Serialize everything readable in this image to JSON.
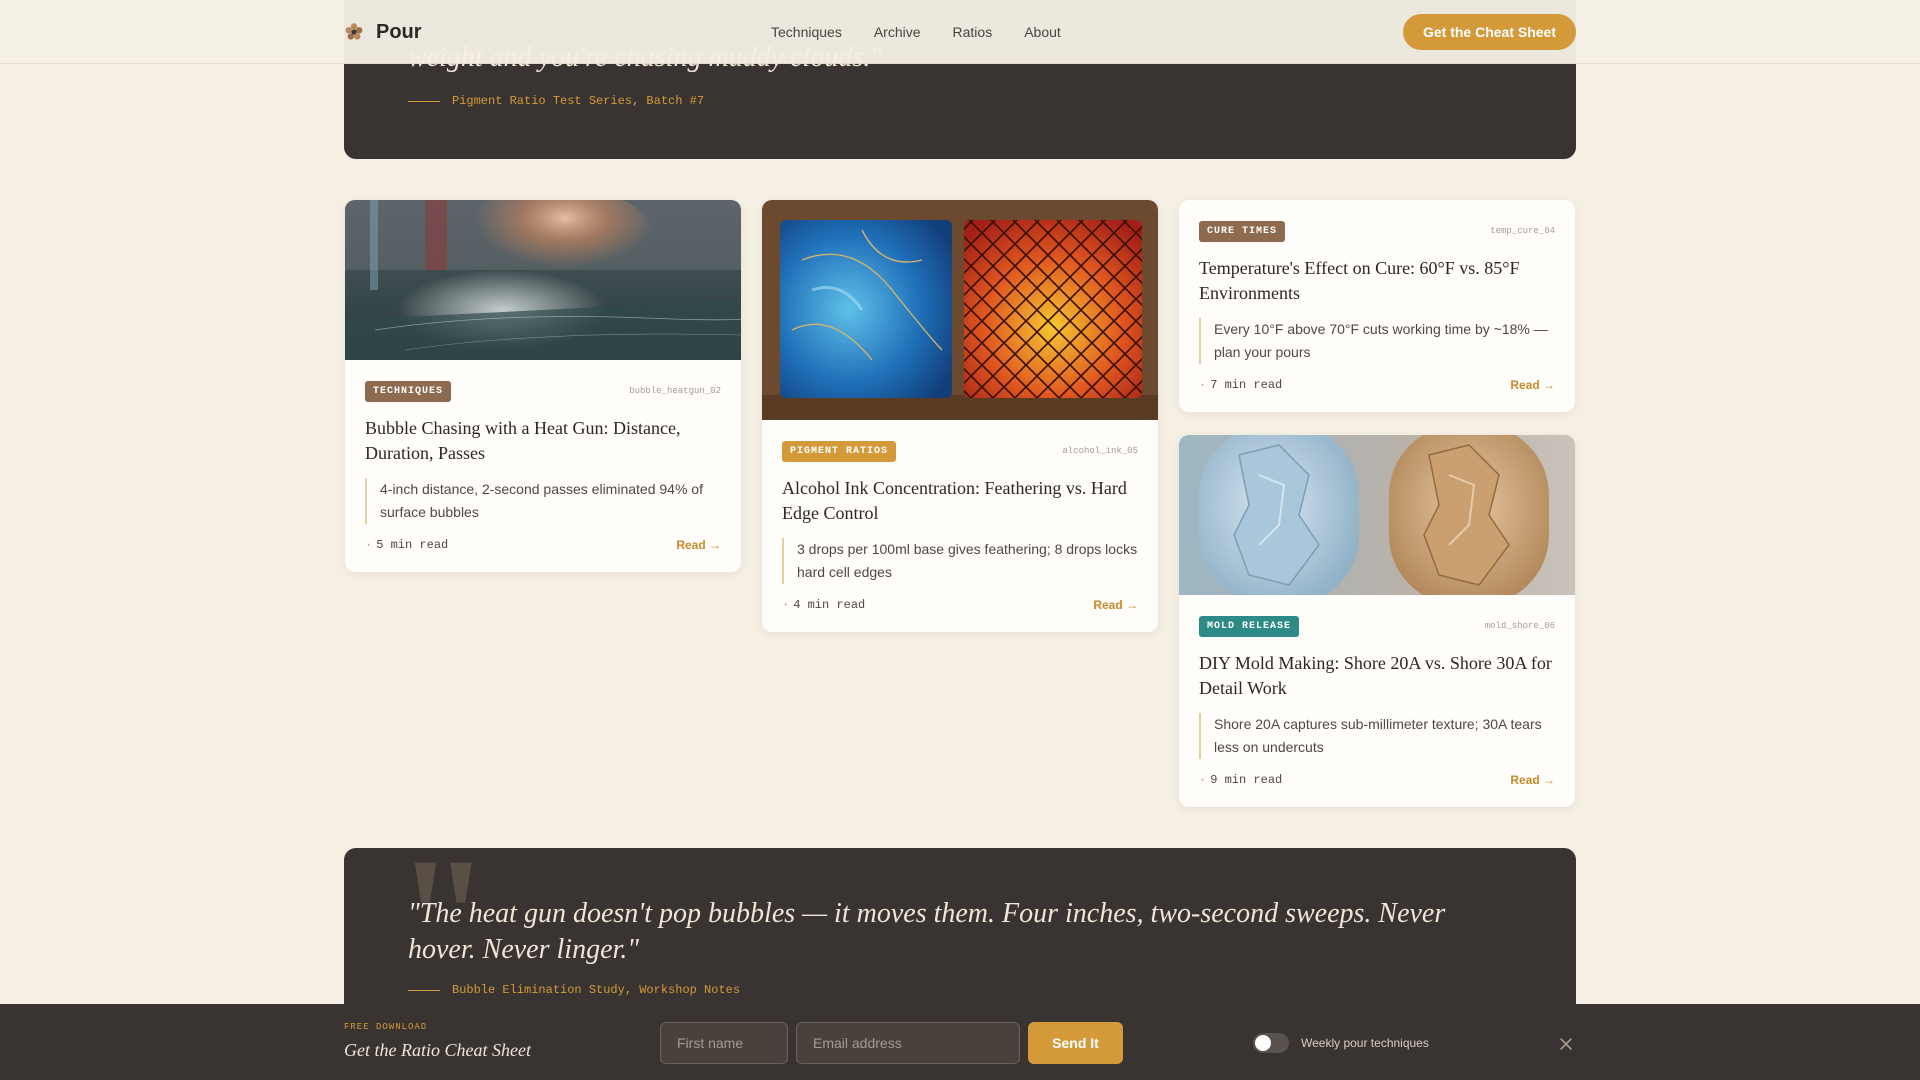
{
  "header": {
    "brand": "Pour",
    "nav": [
      "Techniques",
      "Archive",
      "Ratios",
      "About"
    ],
    "cta": "Get the Cheat Sheet"
  },
  "quote_top": {
    "text": "weight and you're chasing muddy clouds.\"",
    "attribution": "Pigment Ratio Test Series, Batch #7"
  },
  "cards": [
    {
      "badge": "TECHNIQUES",
      "slug": "bubble_heatgun_02",
      "title": "Bubble Chasing with a Heat Gun: Distance, Duration, Passes",
      "excerpt": "4-inch distance, 2-second passes eliminated 94% of surface bubbles",
      "read_time": "5 min read",
      "read_label": "Read →"
    },
    {
      "badge": "PIGMENT RATIOS",
      "slug": "alcohol_ink_05",
      "title": "Alcohol Ink Concentration: Feathering vs. Hard Edge Control",
      "excerpt": "3 drops per 100ml base gives feathering; 8 drops locks hard cell edges",
      "read_time": "4 min read",
      "read_label": "Read →"
    },
    {
      "badge": "CURE TIMES",
      "slug": "temp_cure_04",
      "title": "Temperature's Effect on Cure: 60°F vs. 85°F Environments",
      "excerpt": "Every 10°F above 70°F cuts working time by ~18% — plan your pours",
      "read_time": "7 min read",
      "read_label": "Read →"
    },
    {
      "badge": "MOLD RELEASE",
      "slug": "mold_shore_06",
      "title": "DIY Mold Making: Shore 20A vs. Shore 30A for Detail Work",
      "excerpt": "Shore 20A captures sub-millimeter texture; 30A tears less on undercuts",
      "read_time": "9 min read",
      "read_label": "Read →"
    }
  ],
  "quote_bottom": {
    "text": "\"The heat gun doesn't pop bubbles — it moves them. Four inches, two-second sweeps. Never hover. Never linger.\"",
    "attribution": "Bubble Elimination Study, Workshop Notes"
  },
  "newsletter": {
    "eyebrow": "FREE DOWNLOAD",
    "title": "Get the Ratio Cheat Sheet",
    "first_name_placeholder": "First name",
    "email_placeholder": "Email address",
    "send_label": "Send It",
    "toggle_label": "Weekly pour techniques"
  },
  "colors": {
    "accent": "#d49a3a",
    "badge_techniques": "#8e6a4e",
    "badge_pigment": "#d49a3a",
    "badge_cure": "#8e6a4e",
    "badge_mold": "#2e8a86",
    "dark_panel": "#393431",
    "background": "#f5efe4"
  },
  "icons": {
    "logo": "resin-flower-icon",
    "close": "close-icon"
  }
}
